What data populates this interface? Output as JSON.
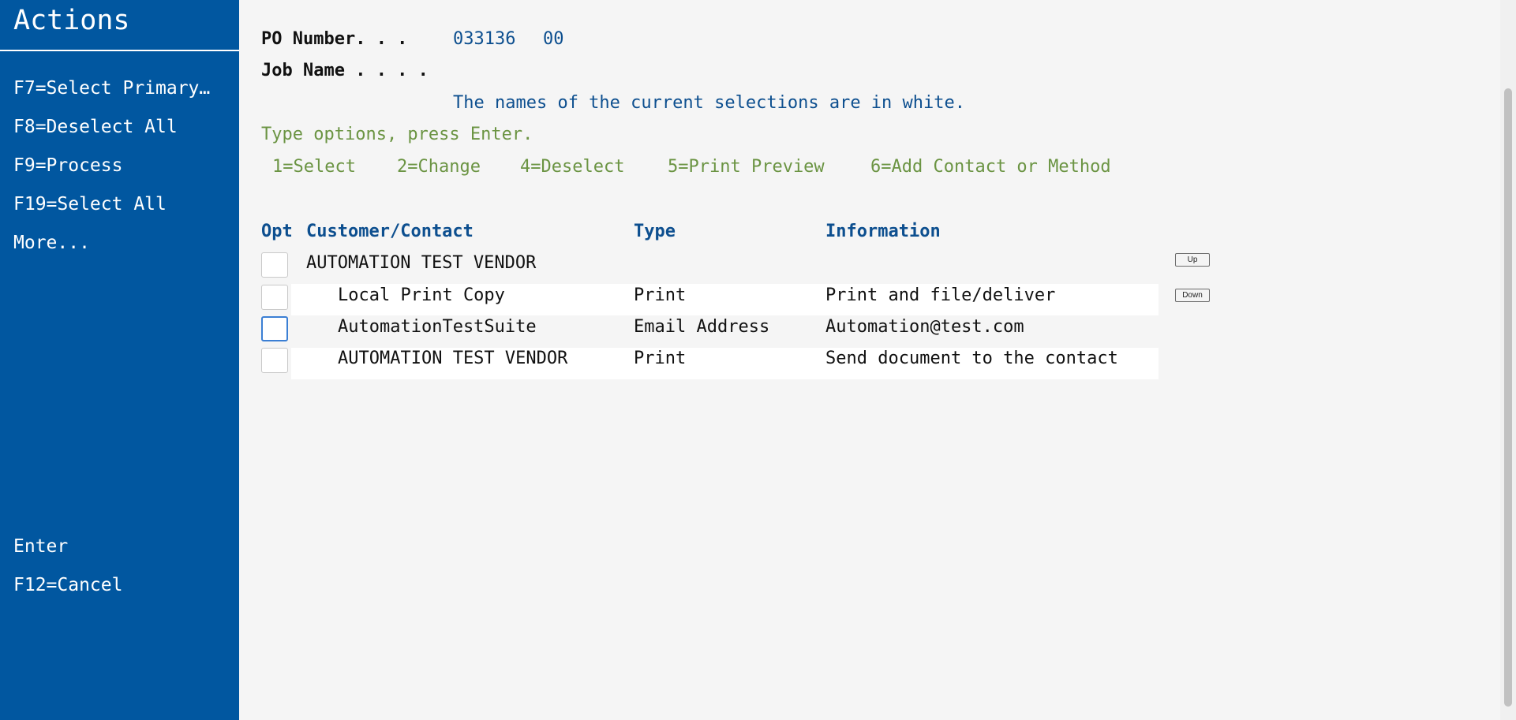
{
  "sidebar": {
    "title": "Actions",
    "actions": [
      {
        "label": "F7=Select Primary…"
      },
      {
        "label": "F8=Deselect All"
      },
      {
        "label": "F9=Process"
      },
      {
        "label": "F19=Select All"
      },
      {
        "label": "More..."
      }
    ],
    "bottom_actions": [
      {
        "label": "Enter"
      },
      {
        "label": "F12=Cancel"
      }
    ]
  },
  "header": {
    "po_label": "PO Number. . .",
    "po_number": "033136",
    "po_suffix": "00",
    "job_label": "Job Name . . . .",
    "job_value": "",
    "info_message": "The names of the current selections are in white.",
    "instructions": "Type options, press Enter.",
    "options": [
      "1=Select",
      "2=Change",
      "4=Deselect",
      "5=Print Preview",
      "6=Add Contact or Method"
    ]
  },
  "table": {
    "columns": {
      "opt": "Opt",
      "customer": "Customer/Contact",
      "type": "Type",
      "info": "Information"
    },
    "rows": [
      {
        "opt": "",
        "customer": "AUTOMATION TEST VENDOR",
        "type": "",
        "info": ""
      },
      {
        "opt": "",
        "customer": "Local Print Copy",
        "type": "Print",
        "info": "Print and file/deliver"
      },
      {
        "opt": "",
        "customer": "AutomationTestSuite",
        "type": "Email Address",
        "info": "Automation@test.com"
      },
      {
        "opt": "",
        "customer": "AUTOMATION TEST VENDOR",
        "type": "Print",
        "info": "Send document to the contact"
      }
    ]
  },
  "paging": {
    "up_label": "Up",
    "down_label": "Down"
  },
  "colors": {
    "sidebar_bg": "#0157a0",
    "page_bg": "#f5f5f5",
    "header_blue": "#0d4f8f",
    "option_green": "#6b9443"
  }
}
